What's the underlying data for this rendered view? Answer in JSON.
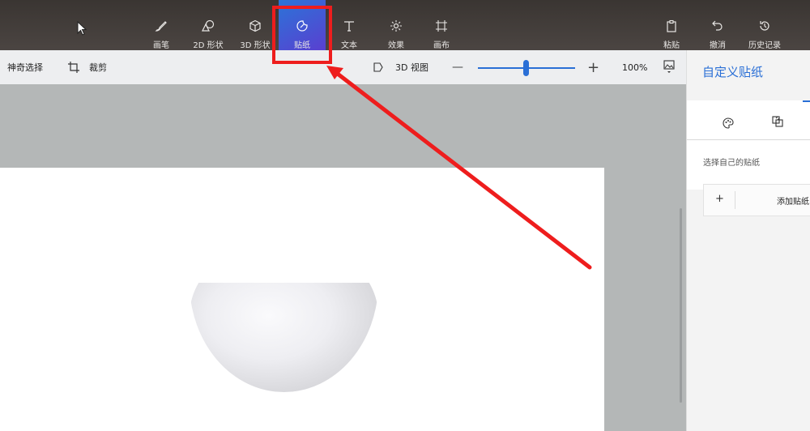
{
  "toolbar": {
    "tools": [
      {
        "label": "画笔",
        "icon": "brush-icon"
      },
      {
        "label": "2D 形状",
        "icon": "2d-shapes-icon"
      },
      {
        "label": "3D 形状",
        "icon": "3d-shapes-icon"
      },
      {
        "label": "贴纸",
        "icon": "sticker-icon",
        "active": true
      },
      {
        "label": "文本",
        "icon": "text-icon"
      },
      {
        "label": "效果",
        "icon": "effects-icon"
      },
      {
        "label": "画布",
        "icon": "canvas-icon"
      }
    ],
    "right": [
      {
        "label": "粘贴",
        "icon": "paste-icon"
      },
      {
        "label": "撤消",
        "icon": "undo-icon"
      },
      {
        "label": "历史记录",
        "icon": "history-icon"
      }
    ]
  },
  "subtoolbar": {
    "magic_select": "神奇选择",
    "crop": "裁剪",
    "view3d": "3D 视图",
    "zoom_minus": "—",
    "zoom_plus": "+",
    "zoom_value": "100%",
    "zoom_fraction": 0.5
  },
  "panel": {
    "title": "自定义贴纸",
    "hint": "选择自己的贴纸",
    "add_plus": "+",
    "add_label": "添加贴纸"
  },
  "colors": {
    "accent": "#2a6fd6",
    "highlight": "#ee1d1d",
    "active_tool": "#3b62d4"
  }
}
